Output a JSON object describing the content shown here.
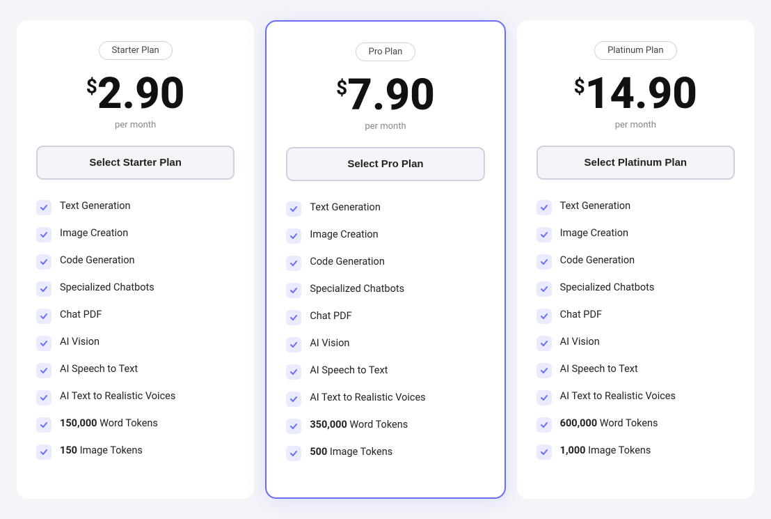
{
  "plans": [
    {
      "id": "starter",
      "name": "Starter Plan",
      "price": "2.90",
      "period": "per month",
      "button_label": "Select Starter Plan",
      "featured": false,
      "features": [
        {
          "text": "Text Generation",
          "bold": false
        },
        {
          "text": "Image Creation",
          "bold": false
        },
        {
          "text": "Code Generation",
          "bold": false
        },
        {
          "text": "Specialized Chatbots",
          "bold": false
        },
        {
          "text": "Chat PDF",
          "bold": false
        },
        {
          "text": "AI Vision",
          "bold": false
        },
        {
          "text": "AI Speech to Text",
          "bold": false
        },
        {
          "text": "AI Text to Realistic Voices",
          "bold": false
        },
        {
          "text_bold": "150,000",
          "text_rest": " Word Tokens"
        },
        {
          "text_bold": "150",
          "text_rest": " Image Tokens"
        }
      ]
    },
    {
      "id": "pro",
      "name": "Pro Plan",
      "price": "7.90",
      "period": "per month",
      "button_label": "Select Pro Plan",
      "featured": true,
      "features": [
        {
          "text": "Text Generation",
          "bold": false
        },
        {
          "text": "Image Creation",
          "bold": false
        },
        {
          "text": "Code Generation",
          "bold": false
        },
        {
          "text": "Specialized Chatbots",
          "bold": false
        },
        {
          "text": "Chat PDF",
          "bold": false
        },
        {
          "text": "AI Vision",
          "bold": false
        },
        {
          "text": "AI Speech to Text",
          "bold": false
        },
        {
          "text": "AI Text to Realistic Voices",
          "bold": false
        },
        {
          "text_bold": "350,000",
          "text_rest": " Word Tokens"
        },
        {
          "text_bold": "500",
          "text_rest": " Image Tokens"
        }
      ]
    },
    {
      "id": "platinum",
      "name": "Platinum Plan",
      "price": "14.90",
      "period": "per month",
      "button_label": "Select Platinum Plan",
      "featured": false,
      "features": [
        {
          "text": "Text Generation",
          "bold": false
        },
        {
          "text": "Image Creation",
          "bold": false
        },
        {
          "text": "Code Generation",
          "bold": false
        },
        {
          "text": "Specialized Chatbots",
          "bold": false
        },
        {
          "text": "Chat PDF",
          "bold": false
        },
        {
          "text": "AI Vision",
          "bold": false
        },
        {
          "text": "AI Speech to Text",
          "bold": false
        },
        {
          "text": "AI Text to Realistic Voices",
          "bold": false
        },
        {
          "text_bold": "600,000",
          "text_rest": " Word Tokens"
        },
        {
          "text_bold": "1,000",
          "text_rest": " Image Tokens"
        }
      ]
    }
  ],
  "colors": {
    "check_bg": "#ebebff",
    "check_color": "#6b6ef9",
    "featured_border": "#6b6ef9"
  }
}
